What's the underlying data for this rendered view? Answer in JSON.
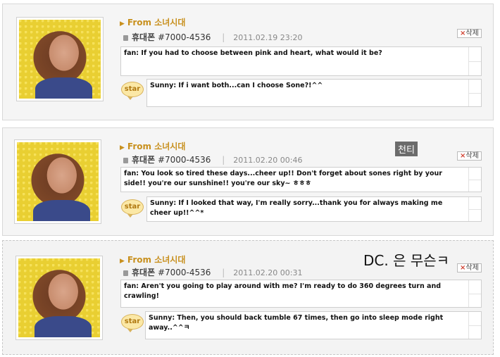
{
  "posts": [
    {
      "from_label": "From 소녀시대",
      "phone_label": "휴대폰",
      "phone_number": "#7000-4536",
      "date": "2011.02.19 23:20",
      "delete_label": "삭제",
      "fan_message": "fan: If you had to choose between pink and heart, what would it be?",
      "star_label": "star",
      "reply": "Sunny: If i want both...can I choose Sone?!^^"
    },
    {
      "from_label": "From 소녀시대",
      "phone_label": "휴대폰",
      "phone_number": "#7000-4536",
      "date": "2011.02.20 00:46",
      "delete_label": "삭제",
      "fan_message": "fan: You look so tired these days...cheer up!! Don't forget about sones right by your side!! you're our sunshine!! you're our sky~ ㅎㅎㅎ",
      "star_label": "star",
      "reply": "Sunny: If I looked that way, I'm really sorry...thank you for always making me cheer up!!^^*"
    },
    {
      "from_label": "From 소녀시대",
      "phone_label": "휴대폰",
      "phone_number": "#7000-4536",
      "date": "2011.02.20 00:31",
      "delete_label": "삭제",
      "fan_message": "fan: Aren't you going to play around with me? I'm ready to do 360 degrees turn and crawling!",
      "star_label": "star",
      "reply": "Sunny: Then, you should back tumble 67 times, then go into sleep mode right away..^^ㅋ"
    }
  ],
  "overlays": {
    "gray_tag": "천티",
    "caption": "DC. 은 무슨ㅋ"
  }
}
